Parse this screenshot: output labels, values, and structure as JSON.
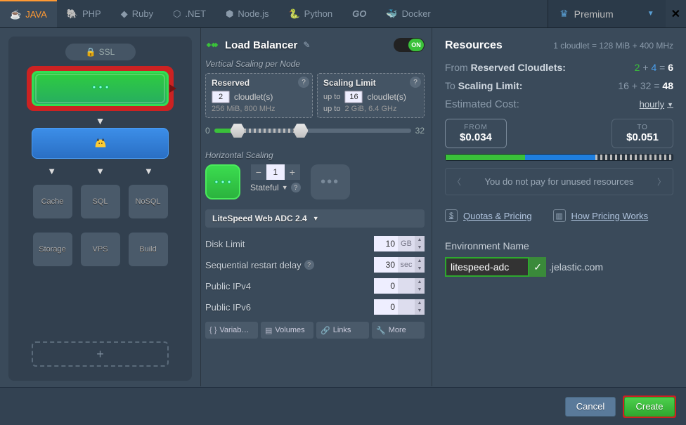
{
  "tabs": {
    "java": "JAVA",
    "php": "PHP",
    "ruby": "Ruby",
    "dotnet": ".NET",
    "node": "Node.js",
    "python": "Python",
    "go": "GO",
    "docker": "Docker"
  },
  "premium": {
    "label": "Premium"
  },
  "topology": {
    "ssl": "SSL",
    "cache": "Cache",
    "sql": "SQL",
    "nosql": "NoSQL",
    "storage": "Storage",
    "vps": "VPS",
    "build": "Build",
    "add": "+"
  },
  "lb": {
    "title": "Load Balancer",
    "toggle": "ON",
    "vertical_label": "Vertical Scaling per Node",
    "reserved": {
      "title": "Reserved",
      "value": "2",
      "units": "cloudlet(s)",
      "fine": "256 MiB, 800 MHz"
    },
    "limit": {
      "title": "Scaling Limit",
      "upto": "up to",
      "value": "16",
      "units": "cloudlet(s)",
      "fine": "2 GiB, 6.4 GHz"
    },
    "slider": {
      "min": "0",
      "max": "32"
    },
    "horizontal_label": "Horizontal Scaling",
    "hscount": "1",
    "stateful": "Stateful",
    "stack": "LiteSpeed Web ADC 2.4",
    "disk_limit": {
      "label": "Disk Limit",
      "value": "10",
      "unit": "GB"
    },
    "restart": {
      "label": "Sequential restart delay",
      "value": "30",
      "unit": "sec"
    },
    "ipv4": {
      "label": "Public IPv4",
      "value": "0"
    },
    "ipv6": {
      "label": "Public IPv6",
      "value": "0"
    },
    "buttons": {
      "variables": "Variab…",
      "volumes": "Volumes",
      "links": "Links",
      "more": "More"
    }
  },
  "resources": {
    "title": "Resources",
    "cloudlet_def": "1 cloudlet = 128 MiB + 400 MHz",
    "from_label": "From",
    "from_bold": "Reserved Cloudlets:",
    "to_label": "To",
    "to_bold": "Scaling Limit:",
    "from_a": "2",
    "from_b": "4",
    "from_sum": "6",
    "to_a": "16",
    "to_b": "32",
    "to_sum": "48",
    "estimated": "Estimated Cost:",
    "hourly": "hourly",
    "cost_from_label": "FROM",
    "cost_from": "$0.034",
    "cost_to_label": "TO",
    "cost_to": "$0.051",
    "info": "You do not pay for unused resources",
    "quotas": "Quotas & Pricing",
    "howpricing": "How Pricing Works",
    "env_label": "Environment Name",
    "env_value": "litespeed-adc",
    "env_domain": ".jelastic.com"
  },
  "footer": {
    "cancel": "Cancel",
    "create": "Create"
  }
}
